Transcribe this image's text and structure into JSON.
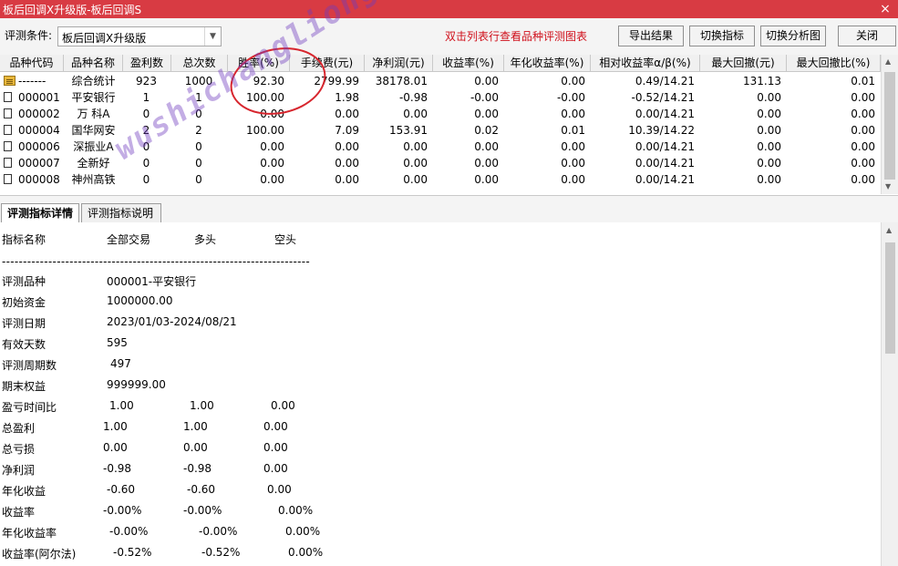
{
  "window": {
    "title": "板后回调X升级版-板后回调S",
    "close_glyph": "×"
  },
  "toolbar": {
    "condition_label": "评测条件:",
    "condition_value": "板后回调X升级版",
    "hint": "双击列表行查看品种评测图表",
    "export_label": "导出结果",
    "switch_indicator_label": "切换指标",
    "switch_chart_label": "切换分析图",
    "close_label": "关闭"
  },
  "table": {
    "columns": [
      "品种代码",
      "品种名称",
      "盈利数",
      "总次数",
      "胜率(%)",
      "手续费(元)",
      "净利润(元)",
      "收益率(%)",
      "年化收益率(%)",
      "相对收益率α/β(%)",
      "最大回撤(元)",
      "最大回撤比(%)"
    ],
    "rows": [
      [
        "-------",
        "综合统计",
        "923",
        "1000",
        "92.30",
        "2799.99",
        "38178.01",
        "0.00",
        "0.00",
        "0.49/14.21",
        "131.13",
        "0.01"
      ],
      [
        "000001",
        "平安银行",
        "1",
        "1",
        "100.00",
        "1.98",
        "-0.98",
        "-0.00",
        "-0.00",
        "-0.52/14.21",
        "0.00",
        "0.00"
      ],
      [
        "000002",
        "万 科A",
        "0",
        "0",
        "0.00",
        "0.00",
        "0.00",
        "0.00",
        "0.00",
        "0.00/14.21",
        "0.00",
        "0.00"
      ],
      [
        "000004",
        "国华网安",
        "2",
        "2",
        "100.00",
        "7.09",
        "153.91",
        "0.02",
        "0.01",
        "10.39/14.22",
        "0.00",
        "0.00"
      ],
      [
        "000006",
        "深振业A",
        "0",
        "0",
        "0.00",
        "0.00",
        "0.00",
        "0.00",
        "0.00",
        "0.00/14.21",
        "0.00",
        "0.00"
      ],
      [
        "000007",
        "全新好",
        "0",
        "0",
        "0.00",
        "0.00",
        "0.00",
        "0.00",
        "0.00",
        "0.00/14.21",
        "0.00",
        "0.00"
      ],
      [
        "000008",
        "神州高铁",
        "0",
        "0",
        "0.00",
        "0.00",
        "0.00",
        "0.00",
        "0.00",
        "0.00/14.21",
        "0.00",
        "0.00"
      ]
    ]
  },
  "tabs": {
    "detail": "评测指标详情",
    "description": "评测指标说明"
  },
  "detail": {
    "headers": [
      "指标名称",
      "全部交易",
      "多头",
      "空头"
    ],
    "separator": "-------------------------------------------------------------------------",
    "info": [
      {
        "label": "评测品种",
        "value": "000001-平安银行"
      },
      {
        "label": "初始资金",
        "value": "1000000.00"
      },
      {
        "label": "评测日期",
        "value": "2023/01/03-2024/08/21"
      },
      {
        "label": "有效天数",
        "value": "595"
      },
      {
        "label": "评测周期数",
        "value": "497"
      },
      {
        "label": "期末权益",
        "value": "999999.00"
      }
    ],
    "metrics": [
      {
        "label": "盈亏时间比",
        "all": "1.00",
        "long": "1.00",
        "short": "0.00"
      },
      {
        "label": "总盈利",
        "all": "1.00",
        "long": "1.00",
        "short": "0.00"
      },
      {
        "label": "总亏损",
        "all": "0.00",
        "long": "0.00",
        "short": "0.00"
      },
      {
        "label": "净利润",
        "all": "-0.98",
        "long": "-0.98",
        "short": "0.00"
      },
      {
        "label": "年化收益",
        "all": "-0.60",
        "long": "-0.60",
        "short": "0.00"
      },
      {
        "label": "收益率",
        "all": "-0.00%",
        "long": "-0.00%",
        "short": "0.00%"
      },
      {
        "label": "年化收益率",
        "all": "-0.00%",
        "long": "-0.00%",
        "short": "0.00%"
      },
      {
        "label": "收益率(阿尔法)",
        "all": "-0.52%",
        "long": "-0.52%",
        "short": "0.00%"
      }
    ]
  },
  "watermark": "wushichangliong.com",
  "colors": {
    "titlebar": "#d83b43",
    "hint_text": "#d0101b",
    "annotation_circle": "#d7262e",
    "watermark": "#6f3cbe"
  },
  "icons": {
    "summary_row": "folder-icon",
    "stock_row": "document-icon"
  }
}
